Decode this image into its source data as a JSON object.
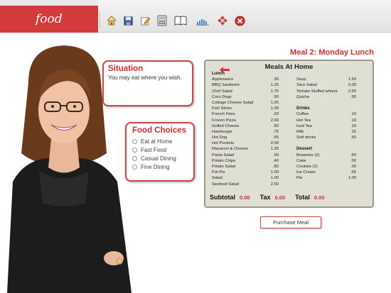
{
  "brand": {
    "title": "food"
  },
  "toolbar": {
    "icons": [
      "home-icon",
      "save-icon",
      "edit-icon",
      "calculator-icon",
      "book-icon",
      "chart-icon",
      "navigation-icon",
      "close-icon"
    ]
  },
  "situation": {
    "title": "Situation",
    "text": "You may eat where you wish."
  },
  "choices": {
    "title": "Food Choices",
    "options": [
      "Eat at Home",
      "Fast Food",
      "Casual Dining",
      "Fine Dining"
    ]
  },
  "meal": {
    "title": "Meal 2: Monday Lunch"
  },
  "menu": {
    "title": "Meals At Home",
    "lunch_heading": "Lunch",
    "lunch": [
      {
        "name": "Applesauce",
        "price": ".30"
      },
      {
        "name": "BBQ Sandwich",
        "price": "1.25"
      },
      {
        "name": "Chef Salad",
        "price": "1.75"
      },
      {
        "name": "Corn Dogs",
        "price": ".50"
      },
      {
        "name": "Cottage Cheese Salad",
        "price": "1.25"
      },
      {
        "name": "Fish Sticks",
        "price": "1.00"
      },
      {
        "name": "French Fries",
        "price": ".20"
      },
      {
        "name": "Frozen Pizza",
        "price": "2.00"
      },
      {
        "name": "Grilled Cheese",
        "price": ".50"
      },
      {
        "name": "Hamburger",
        "price": ".75"
      },
      {
        "name": "Hot Dog",
        "price": ".65"
      },
      {
        "name": "Hot Pockets",
        "price": "2.00"
      },
      {
        "name": "Macaroni & Cheese",
        "price": "1.25"
      },
      {
        "name": "Pasta Salad",
        "price": ".50"
      },
      {
        "name": "Potato Chips",
        "price": ".40"
      },
      {
        "name": "Potato Salad",
        "price": ".80"
      },
      {
        "name": "Pot Pie",
        "price": "1.00"
      },
      {
        "name": "Salad",
        "price": "1.00"
      },
      {
        "name": "Seafood Salad",
        "price": "2.50"
      }
    ],
    "lunch_extra": [
      {
        "name": "Soup",
        "price": "1.50"
      },
      {
        "name": "Taco Salad",
        "price": "2.00"
      },
      {
        "name": "Tomato Stuffed w/tuna",
        "price": "2.50"
      },
      {
        "name": "Quiche",
        "price": ".50"
      }
    ],
    "drinks_heading": "Drinks",
    "drinks": [
      {
        "name": "Coffee",
        "price": ".10"
      },
      {
        "name": "Hot Tea",
        "price": ".10"
      },
      {
        "name": "Iced Tea",
        "price": ".10"
      },
      {
        "name": "Milk",
        "price": ".15"
      },
      {
        "name": "Soft drinks",
        "price": ".50"
      }
    ],
    "dessert_heading": "Dessert",
    "dessert": [
      {
        "name": "Brownies (2)",
        "price": ".50"
      },
      {
        "name": "Cake",
        "price": ".50"
      },
      {
        "name": "Cookies (2)",
        "price": ".30"
      },
      {
        "name": "Ice Cream",
        "price": ".65"
      },
      {
        "name": "Pie",
        "price": "1.00"
      }
    ],
    "totals": {
      "subtotal_label": "Subtotal",
      "subtotal": "0.00",
      "tax_label": "Tax",
      "tax": "0.00",
      "total_label": "Total",
      "total": "0.00"
    }
  },
  "purchase": {
    "label": "Purchase Meal"
  },
  "colors": {
    "accent": "#c8302f",
    "brand_bar": "#d33a3a",
    "menu_bg": "#dfdfd4"
  }
}
